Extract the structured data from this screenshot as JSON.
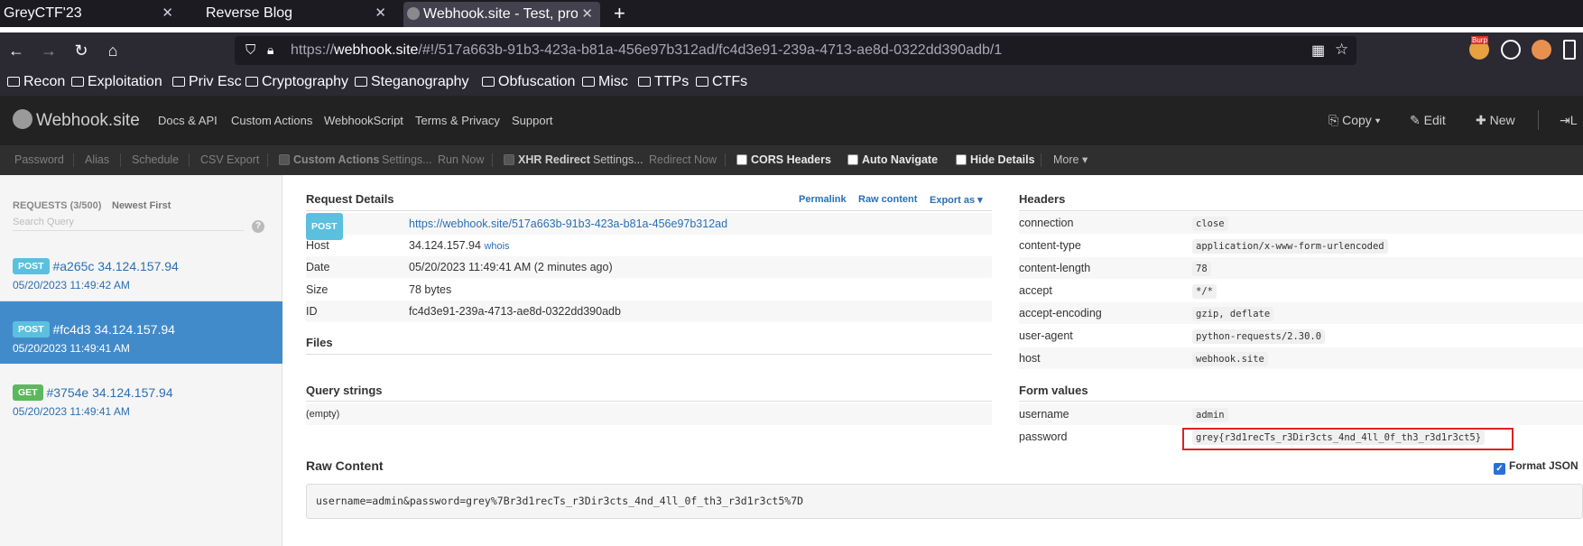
{
  "browser": {
    "tabs": [
      {
        "title": "GreyCTF'23",
        "close": "✕"
      },
      {
        "title": "Reverse Blog",
        "close": "✕"
      },
      {
        "title": "Webhook.site - Test, proc",
        "close": "✕"
      }
    ],
    "new_tab": "+",
    "url_host": "https://webhook.site/",
    "url_path": "#!/517a663b-91b3-423a-b81a-456e97b312ad/fc4d3e91-239a-4713-ae8d-0322dd390adb/1",
    "url_host_bold": "webhook.site",
    "url_scheme": "https://",
    "bookmarks": [
      "Recon",
      "Exploitation",
      "Priv Esc",
      "Cryptography",
      "Steganography",
      "Obfuscation",
      "Misc",
      "TTPs",
      "CTFs"
    ],
    "ext_label": "Burp"
  },
  "app": {
    "brand": "Webhook.site",
    "nav": [
      "Docs & API",
      "Custom Actions",
      "WebhookScript",
      "Terms & Privacy",
      "Support"
    ],
    "right_nav": {
      "copy": "Copy ▾",
      "edit": "Edit",
      "new": "New",
      "login": "L"
    }
  },
  "toolbar": {
    "password": "Password",
    "alias": "Alias",
    "schedule": "Schedule",
    "csv_export": "CSV Export",
    "custom_actions": "Custom Actions",
    "settings1": "Settings...",
    "run_now": "Run Now",
    "xhr_redirect": "XHR Redirect",
    "settings2": "Settings...",
    "redirect_now": "Redirect Now",
    "cors_headers": "CORS Headers",
    "auto_navigate": "Auto Navigate",
    "hide_details": "Hide Details",
    "more": "More ▾"
  },
  "sidebar": {
    "requests_header": "REQUESTS (3/500)",
    "newest_first": "Newest First",
    "search_placeholder": "Search Query",
    "help": "?",
    "items": [
      {
        "method": "POST",
        "title": "#a265c 34.124.157.94",
        "date": "05/20/2023 11:49:42 AM"
      },
      {
        "method": "POST",
        "title": "#fc4d3 34.124.157.94",
        "date": "05/20/2023 11:49:41 AM"
      },
      {
        "method": "GET",
        "title": "#3754e 34.124.157.94",
        "date": "05/20/2023 11:49:41 AM"
      }
    ]
  },
  "details": {
    "title": "Request Details",
    "permalink": "Permalink",
    "raw_content_link": "Raw content",
    "export_as": "Export as ▾",
    "method": "POST",
    "url": "https://webhook.site/517a663b-91b3-423a-b81a-456e97b312ad",
    "host_label": "Host",
    "host_value": "34.124.157.94",
    "whois": "whois",
    "date_label": "Date",
    "date_value": "05/20/2023 11:49:41 AM (2 minutes ago)",
    "size_label": "Size",
    "size_value": "78 bytes",
    "id_label": "ID",
    "id_value": "fc4d3e91-239a-4713-ae8d-0322dd390adb",
    "files_title": "Files",
    "query_title": "Query strings",
    "query_empty": "(empty)"
  },
  "headers": {
    "title": "Headers",
    "rows": [
      {
        "k": "connection",
        "v": "close"
      },
      {
        "k": "content-type",
        "v": "application/x-www-form-urlencoded"
      },
      {
        "k": "content-length",
        "v": "78"
      },
      {
        "k": "accept",
        "v": "*/*"
      },
      {
        "k": "accept-encoding",
        "v": "gzip, deflate"
      },
      {
        "k": "user-agent",
        "v": "python-requests/2.30.0"
      },
      {
        "k": "host",
        "v": "webhook.site"
      }
    ]
  },
  "form": {
    "title": "Form values",
    "rows": [
      {
        "k": "username",
        "v": "admin"
      },
      {
        "k": "password",
        "v": "grey{r3d1recTs_r3Dir3cts_4nd_4ll_0f_th3_r3d1r3ct5}"
      }
    ]
  },
  "raw": {
    "title": "Raw Content",
    "format_json": "Format JSON",
    "content": "username=admin&password=grey%7Br3d1recTs_r3Dir3cts_4nd_4ll_0f_th3_r3d1r3ct5%7D"
  },
  "colors": {
    "accent": "#428bca",
    "post": "#5bc0de",
    "get": "#5cb85c",
    "highlight": "#e02020"
  }
}
